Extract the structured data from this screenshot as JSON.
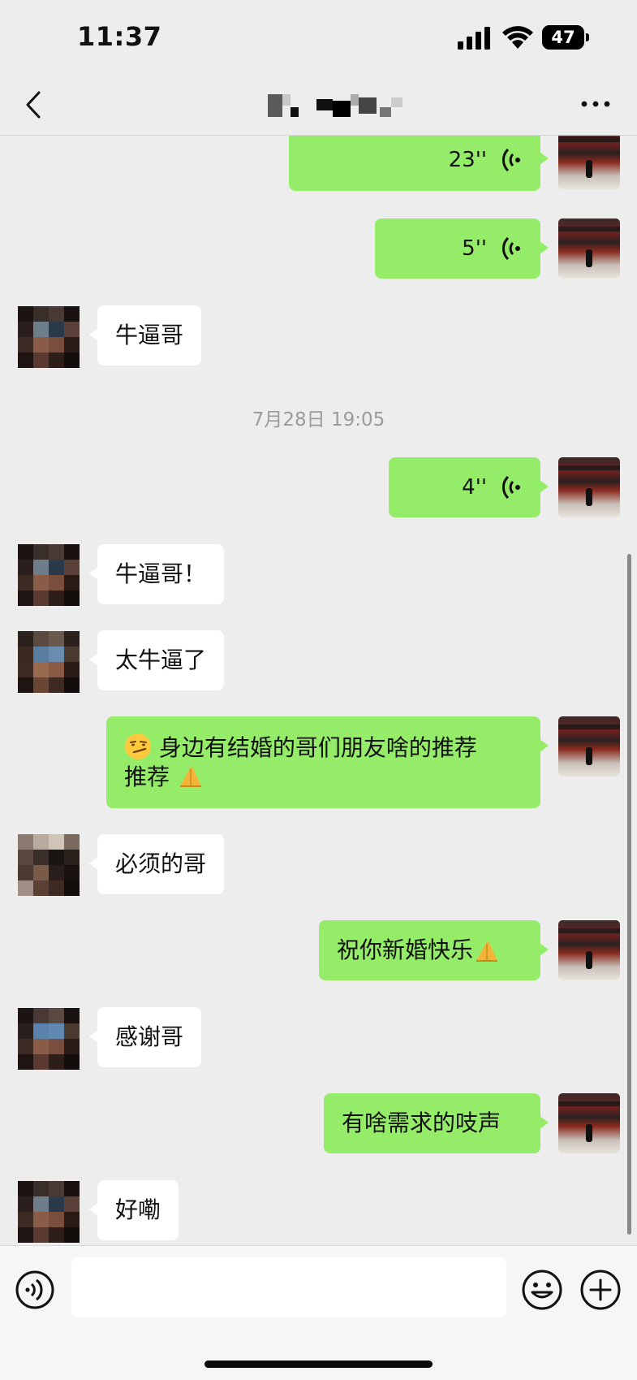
{
  "status_bar": {
    "time": "11:37",
    "battery": "47"
  },
  "header": {
    "title": ""
  },
  "messages": [
    {
      "side": "me",
      "type": "voice",
      "duration": "23''"
    },
    {
      "side": "me",
      "type": "voice",
      "duration": "5''"
    },
    {
      "side": "other",
      "type": "text",
      "text": "牛逼哥"
    },
    {
      "type": "timestamp",
      "text": "7月28日 19:05"
    },
    {
      "side": "me",
      "type": "voice",
      "duration": "4''"
    },
    {
      "side": "other",
      "type": "text",
      "text": "牛逼哥！"
    },
    {
      "side": "other",
      "type": "text",
      "text": "太牛逼了"
    },
    {
      "side": "me",
      "type": "text",
      "emoji_start": "smirk-emoji",
      "line1": "身边有结婚的哥们朋友啥的推荐",
      "line2": "推荐",
      "emoji_end": "pray-emoji"
    },
    {
      "side": "other",
      "type": "text",
      "text": "必须的哥"
    },
    {
      "side": "me",
      "type": "text",
      "text": "祝你新婚快乐",
      "emoji_end": "pray-emoji"
    },
    {
      "side": "other",
      "type": "text",
      "text": "感谢哥"
    },
    {
      "side": "me",
      "type": "text",
      "text": "有啥需求的吱声"
    },
    {
      "side": "other",
      "type": "text",
      "text": "好嘞"
    }
  ],
  "input": {
    "value": "",
    "placeholder": ""
  },
  "colors": {
    "me_bubble": "#95ec69",
    "other_bubble": "#ffffff",
    "background": "#ededed"
  }
}
